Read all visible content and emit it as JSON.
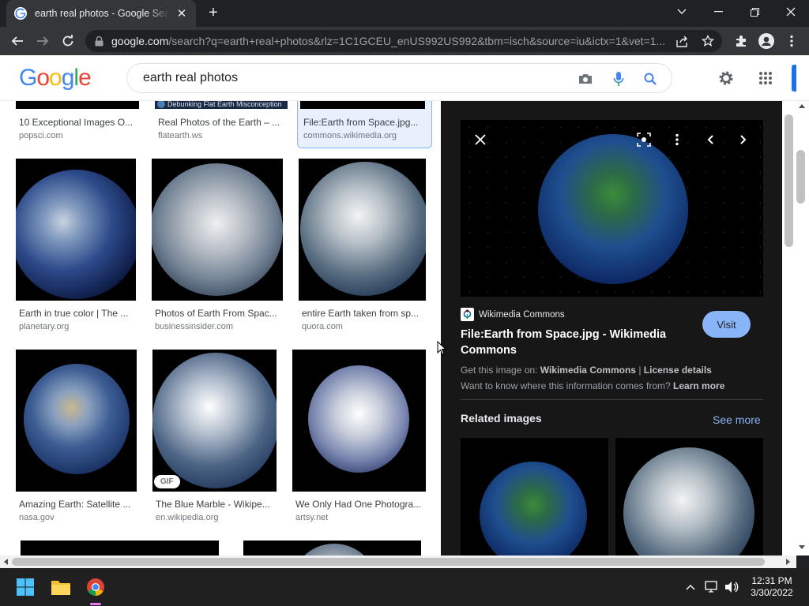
{
  "browser": {
    "tab_title": "earth real photos - Google Search",
    "tab_close": "✕",
    "new_tab": "+",
    "url_host": "google.com",
    "url_rest": "/search?q=earth+real+photos&rlz=1C1GCEU_enUS992US992&tbm=isch&source=iu&ictx=1&vet=1..."
  },
  "google": {
    "logo": [
      "G",
      "o",
      "o",
      "g",
      "l",
      "e"
    ],
    "query": "earth real photos"
  },
  "results": {
    "row0": [
      {
        "caption": "10 Exceptional Images O...",
        "source": "popsci.com"
      },
      {
        "caption": "Real Photos of the Earth – ...",
        "source": "flatearth.ws",
        "banner": "Debunking Flat Earth Misconception"
      },
      {
        "caption": "File:Earth from Space.jpg...",
        "source": "commons.wikimedia.org"
      }
    ],
    "row1": [
      {
        "caption": "Earth in true color | The ...",
        "source": "planetary.org"
      },
      {
        "caption": "Photos of Earth From Spac...",
        "source": "businessinsider.com"
      },
      {
        "caption": "entire Earth taken from sp...",
        "source": "quora.com"
      }
    ],
    "row2": [
      {
        "caption": "Amazing Earth: Satellite ...",
        "source": "nasa.gov"
      },
      {
        "caption": "The Blue Marble - Wikipe...",
        "source": "en.wikipedia.org",
        "badge": "GIF"
      },
      {
        "caption": "We Only Had One Photogra...",
        "source": "artsy.net"
      }
    ]
  },
  "panel": {
    "site_name": "Wikimedia Commons",
    "title": "File:Earth from Space.jpg - Wikimedia Commons",
    "visit_label": "Visit",
    "get_image_prefix": "Get this image on:",
    "get_image_source": "Wikimedia Commons",
    "separator": "|",
    "license_link": "License details",
    "want_to_know": "Want to know where this information comes from?",
    "learn_more": "Learn more",
    "related_title": "Related images",
    "see_more": "See more"
  },
  "taskbar": {
    "time": "12:31 PM",
    "date": "3/30/2022"
  },
  "colors": {
    "accent": "#8ab4f8",
    "google_blue": "#4285f4",
    "panel_bg": "#171717"
  }
}
